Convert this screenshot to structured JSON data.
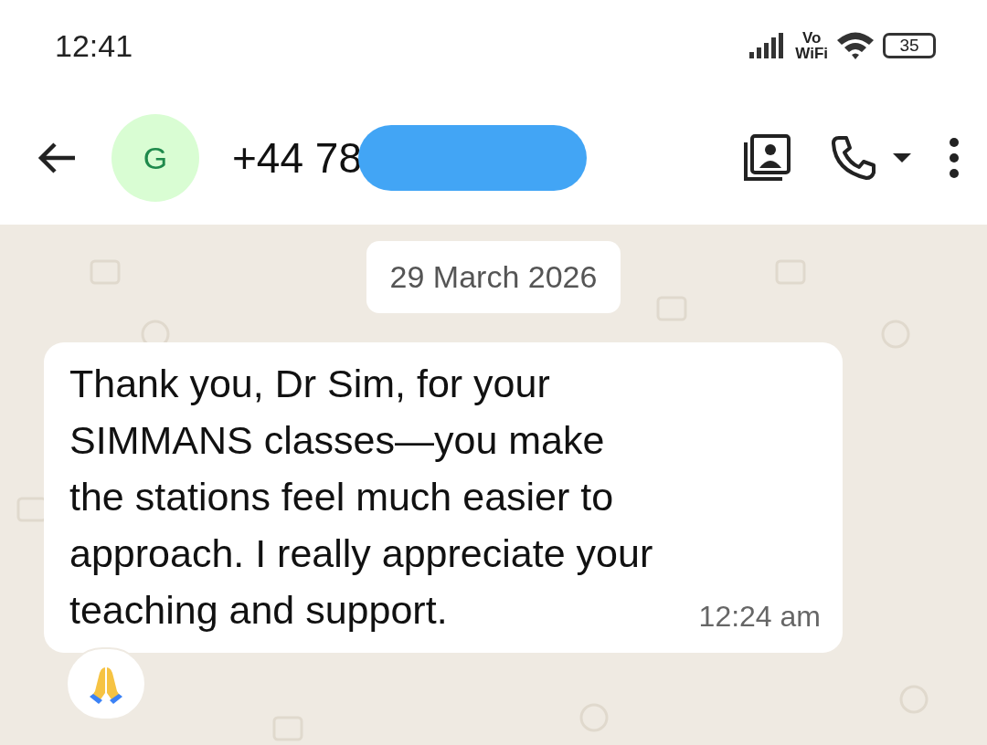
{
  "status_bar": {
    "time": "12:41",
    "network_label": [
      "Vo",
      "WiFi"
    ],
    "battery": "35"
  },
  "header": {
    "avatar_letter": "G",
    "phone": "+44 78",
    "redacted": true
  },
  "date_chip": "29 March 2026",
  "messages": [
    {
      "text": "Thank you, Dr Sim, for your SIMMANS classes—you make the stations feel much easier to approach. I really appreciate your teaching and support.",
      "time": "12:24 am",
      "reacted": true
    }
  ]
}
